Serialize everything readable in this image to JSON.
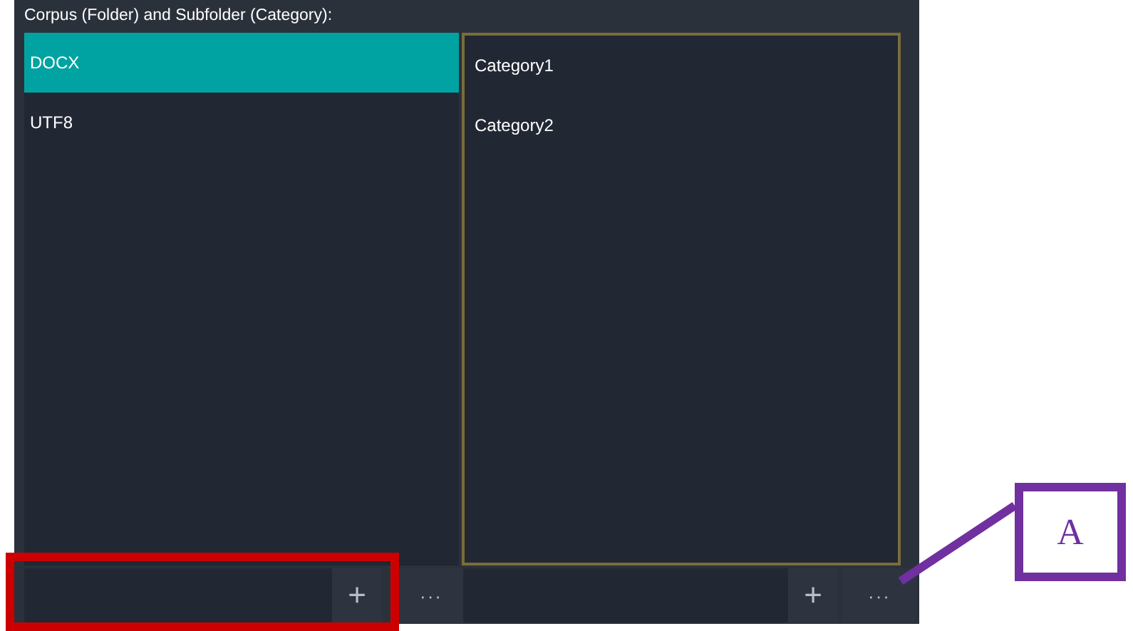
{
  "heading": "Corpus (Folder) and Subfolder (Category):",
  "corpora": [
    {
      "label": "DOCX",
      "selected": true
    },
    {
      "label": "UTF8",
      "selected": false
    }
  ],
  "categories": [
    {
      "label": "Category1",
      "selected": false
    },
    {
      "label": "Category2",
      "selected": false
    }
  ],
  "corpus_controls": {
    "add": "+",
    "more": "···"
  },
  "category_controls": {
    "add": "+",
    "more": "···"
  },
  "callout": {
    "label": "A"
  }
}
